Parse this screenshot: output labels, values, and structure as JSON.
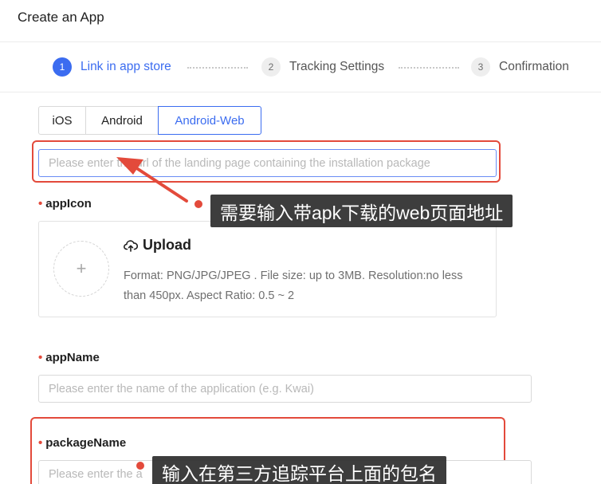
{
  "header": {
    "title": "Create an App"
  },
  "steps": [
    {
      "num": "1",
      "label": "Link in app store",
      "state": "active"
    },
    {
      "num": "2",
      "label": "Tracking Settings",
      "state": "inactive"
    },
    {
      "num": "3",
      "label": "Confirmation",
      "state": "inactive"
    }
  ],
  "platform_tabs": [
    {
      "label": "iOS",
      "selected": false
    },
    {
      "label": "Android",
      "selected": false
    },
    {
      "label": "Android-Web",
      "selected": true
    }
  ],
  "url_input": {
    "placeholder": "Please enter the url of the landing page containing the installation package"
  },
  "app_icon": {
    "label": "appIcon",
    "required_mark": "•",
    "upload_label": "Upload",
    "hint": "Format: PNG/JPG/JPEG . File size: up to 3MB. Resolution:no less than 450px. Aspect Ratio: 0.5 ~ 2",
    "plus": "+"
  },
  "app_name": {
    "label": "appName",
    "required_mark": "•",
    "placeholder": "Please enter the name of the application (e.g. Kwai)"
  },
  "package_name": {
    "label": "packageName",
    "required_mark": "•",
    "placeholder": "Please enter the a"
  },
  "annotations": {
    "url_note": "需要输入带apk下载的web页面地址",
    "package_note": "输入在第三方追踪平台上面的包名"
  },
  "colors": {
    "accent": "#3b6cf0",
    "highlight": "#e34a3b",
    "annotation_bg": "#2c2c2c"
  }
}
